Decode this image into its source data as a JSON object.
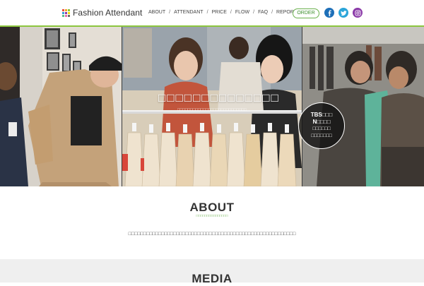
{
  "header": {
    "logo_text": "Fashion Attendant",
    "logo_colors": [
      "#e84e3c",
      "#f5a623",
      "#8cc63f",
      "#3a9ad9",
      "#8b3aa8",
      "#f5d90a",
      "#5bbf8a",
      "#e86aa8",
      "#6c6c6c"
    ],
    "nav": [
      {
        "label": "ABOUT",
        "sep": "/"
      },
      {
        "label": "ATTENDANT",
        "sep": "/"
      },
      {
        "label": "PRICE",
        "sep": "/"
      },
      {
        "label": "FLOW",
        "sep": "/"
      },
      {
        "label": "FAQ",
        "sep": "/"
      },
      {
        "label": "REPORT",
        "sep": ""
      }
    ],
    "order_label": "ORDER",
    "accent": "#8cc63f",
    "social": [
      {
        "name": "facebook-icon",
        "color": "#1d6fb8"
      },
      {
        "name": "twitter-icon",
        "color": "#2ba5d9"
      },
      {
        "name": "instagram-icon",
        "color": "#8b3aa8"
      }
    ]
  },
  "hero": {
    "title": "□□□□□□□□□□□□□□",
    "subtitle": "□□□□□□□□□□□□□□□□□□□□□□□□□□□",
    "badge": {
      "line1": "TBS□□□",
      "line2": "N□□□□",
      "line3": "□□□□□□",
      "line4": "□□□□□□□"
    }
  },
  "about": {
    "title": "ABOUT",
    "subtitle": "□□□□□□□□□□□□□□□",
    "text": "□□□□□□□□□□□□□□□□□□□□□□□□□□□□□□□□□□□□□□□□□□□□□□□□□□□□□□□□"
  },
  "media": {
    "title": "MEDIA"
  }
}
